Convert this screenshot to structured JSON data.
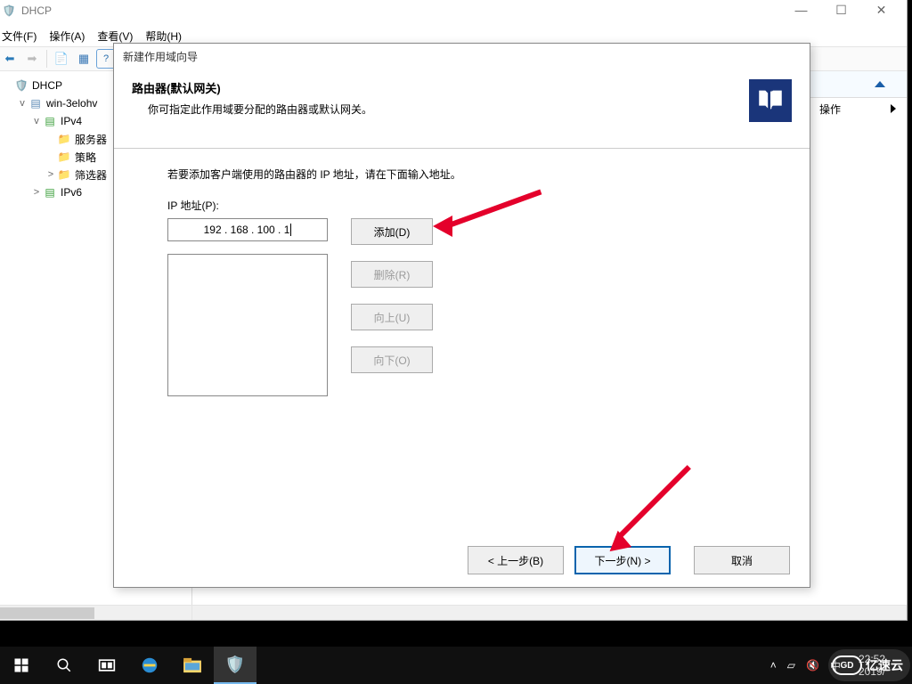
{
  "window": {
    "title": "DHCP",
    "menus": [
      "文件(F)",
      "操作(A)",
      "查看(V)",
      "帮助(H)"
    ]
  },
  "tree": {
    "items": [
      {
        "indent": 0,
        "exp": "",
        "icon": "dhcp-root-icon",
        "label": "DHCP"
      },
      {
        "indent": 1,
        "exp": "v",
        "icon": "server-icon",
        "label": "win-3elohv"
      },
      {
        "indent": 2,
        "exp": "v",
        "icon": "ipv4-icon",
        "label": "IPv4"
      },
      {
        "indent": 3,
        "exp": "",
        "icon": "folder-icon",
        "label": "服务器"
      },
      {
        "indent": 3,
        "exp": "",
        "icon": "folder-icon",
        "label": "策略"
      },
      {
        "indent": 3,
        "exp": ">",
        "icon": "folder-icon",
        "label": "筛选器"
      },
      {
        "indent": 2,
        "exp": ">",
        "icon": "ipv6-icon",
        "label": "IPv6"
      }
    ]
  },
  "actions": {
    "label": "操作"
  },
  "wizard": {
    "title": "新建作用域向导",
    "heading": "路由器(默认网关)",
    "subheading": "你可指定此作用域要分配的路由器或默认网关。",
    "instruction": "若要添加客户端使用的路由器的 IP 地址，请在下面输入地址。",
    "ip_label": "IP 地址(P):",
    "ip_value": "192 . 168 . 100 .   1",
    "buttons": {
      "add": "添加(D)",
      "remove": "删除(R)",
      "up": "向上(U)",
      "down": "向下(O)",
      "back": "< 上一步(B)",
      "next": "下一步(N) >",
      "cancel": "取消"
    }
  },
  "taskbar": {
    "time": "22:52",
    "date": "2019/"
  },
  "watermark": "亿速云"
}
